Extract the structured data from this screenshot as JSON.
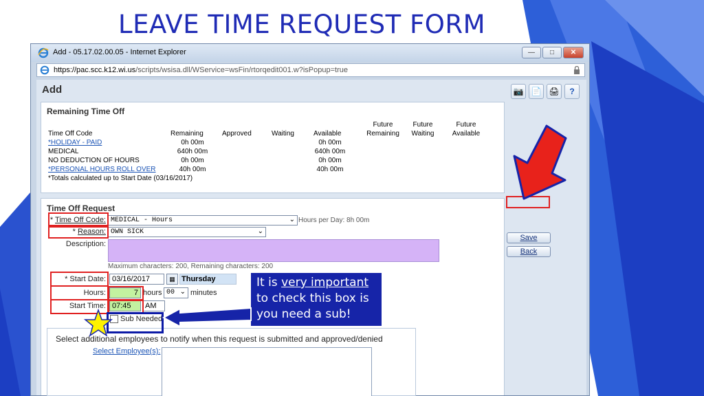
{
  "slide": {
    "title": "LEAVE TIME REQUEST FORM"
  },
  "browser": {
    "window_title": "Add - 05.17.02.00.05 - Internet Explorer",
    "url_prefix": "https://pac.scc.",
    "url_domain": "k12.wi.us",
    "url_rest": "/scripts/wsisa.dll/WService=wsFin/rtorqedit001.w?isPopup=true",
    "controls": {
      "minimize": "—",
      "maximize": "□",
      "close": "✕"
    }
  },
  "page": {
    "heading": "Add",
    "toolbar_icons": [
      "camera-icon",
      "note-icon",
      "print-icon",
      "help-icon"
    ],
    "toolbar_glyphs": [
      "📷",
      "📄",
      "🖨",
      "?"
    ]
  },
  "remaining_time_off": {
    "title": "Remaining Time Off",
    "future_headers": {
      "remaining_top": "Future",
      "remaining_bottom": "Remaining",
      "waiting_top": "Future",
      "waiting_bottom": "Waiting",
      "available_top": "Future",
      "available_bottom": "Available"
    },
    "columns": [
      "Time Off Code",
      "Remaining",
      "Approved",
      "Waiting",
      "Available"
    ],
    "rows": [
      {
        "code": "*HOLIDAY - PAID",
        "link": true,
        "remaining": "0h 00m",
        "available": "0h 00m"
      },
      {
        "code": "MEDICAL",
        "link": false,
        "remaining": "640h 00m",
        "available": "640h 00m"
      },
      {
        "code": "NO DEDUCTION OF HOURS",
        "link": false,
        "remaining": "0h 00m",
        "available": "0h 00m"
      },
      {
        "code": "*PERSONAL HOURS ROLL OVER",
        "link": true,
        "remaining": "40h 00m",
        "available": "40h 00m"
      }
    ],
    "footnote": "*Totals calculated up to Start Date (03/16/2017)"
  },
  "request": {
    "title": "Time Off Request",
    "time_off_code_label": "Time Off Code:",
    "time_off_code_value": "MEDICAL - Hours",
    "hours_per_day": "Hours per Day: 8h 00m",
    "reason_label": "Reason:",
    "reason_value": "OWN SICK",
    "description_label": "Description:",
    "description_value": "",
    "max_chars_note": "Maximum characters: 200, Remaining characters: 200",
    "start_date_label": "Start Date:",
    "start_date_value": "03/16/2017",
    "day_of_week": "Thursday",
    "hours_label": "Hours:",
    "hours_value": "7",
    "hours_unit": "hours",
    "minutes_value": "00",
    "minutes_unit": "minutes",
    "start_time_label": "Start Time:",
    "start_time_value": "07:45",
    "am_pm_value": "AM",
    "sub_needed_label": "Sub Needed",
    "sub_needed_checked": false
  },
  "side_buttons": {
    "save": "Save",
    "back": "Back"
  },
  "notify": {
    "text": "Select additional employees to notify when this request is submitted and approved/denied",
    "select_link": "Select Employee(s):"
  },
  "callout": {
    "line1_prefix": "It is ",
    "line1_emphasis": "very important",
    "line2": "to check this box is",
    "line3": "you need a sub!"
  },
  "colors": {
    "title_blue": "#1f2bb5",
    "callout_blue": "#1624a8",
    "highlight_red": "#e02020",
    "arrow_red": "#e8221b",
    "description_purple": "#d5b3f7",
    "hours_green": "#c3f2a0",
    "star_yellow": "#fff200"
  }
}
